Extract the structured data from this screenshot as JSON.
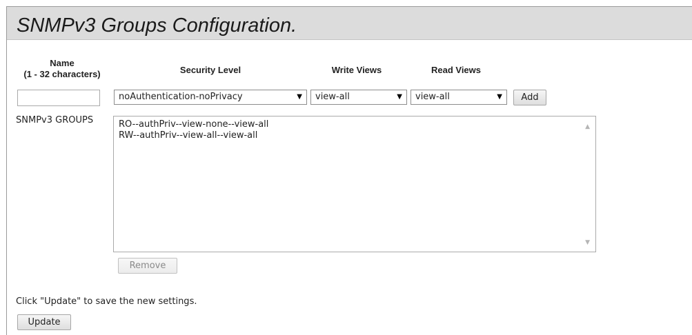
{
  "page": {
    "title": "SNMPv3 Groups Configuration."
  },
  "form": {
    "headers": {
      "name_line1": "Name",
      "name_line2": "(1 - 32 characters)",
      "security_level": "Security Level",
      "write_views": "Write Views",
      "read_views": "Read Views"
    },
    "name_value": "",
    "security_level_value": "noAuthentication-noPrivacy",
    "write_views_value": "view-all",
    "read_views_value": "view-all",
    "add_label": "Add",
    "dropdown_icon": "triangle-down-icon"
  },
  "groups": {
    "label": "SNMPv3 GROUPS",
    "items": [
      "RO--authPriv--view-none--view-all",
      "RW--authPriv--view-all--view-all"
    ],
    "remove_label": "Remove"
  },
  "footer": {
    "note": "Click \"Update\" to save the new settings.",
    "update_label": "Update"
  }
}
